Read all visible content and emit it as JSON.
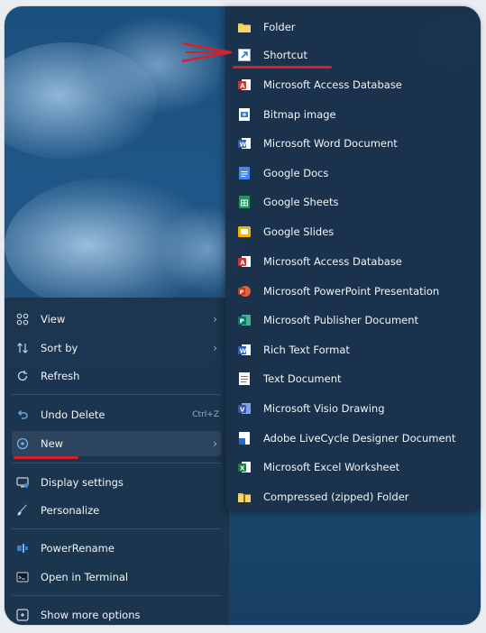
{
  "context_menu": {
    "items": [
      {
        "label": "View",
        "icon": "grid-icon",
        "arrow": "›"
      },
      {
        "label": "Sort by",
        "icon": "sort-icon",
        "arrow": "›"
      },
      {
        "label": "Refresh",
        "icon": "refresh-icon"
      },
      {
        "label": "Undo Delete",
        "icon": "undo-icon",
        "accelerator": "Ctrl+Z"
      },
      {
        "label": "New",
        "icon": "new-icon",
        "arrow": "›"
      },
      {
        "label": "Display settings",
        "icon": "display-settings-icon"
      },
      {
        "label": "Personalize",
        "icon": "brush-icon"
      },
      {
        "label": "PowerRename",
        "icon": "powerrename-icon"
      },
      {
        "label": "Open in Terminal",
        "icon": "terminal-icon"
      },
      {
        "label": "Show more options",
        "icon": "more-options-icon"
      }
    ]
  },
  "new_submenu": {
    "items": [
      {
        "label": "Folder",
        "icon": "folder-icon"
      },
      {
        "label": "Shortcut",
        "icon": "shortcut-icon"
      },
      {
        "label": "Microsoft Access Database",
        "icon": "access-icon"
      },
      {
        "label": "Bitmap image",
        "icon": "bitmap-icon"
      },
      {
        "label": "Microsoft Word Document",
        "icon": "word-icon"
      },
      {
        "label": "Google Docs",
        "icon": "google-docs-icon"
      },
      {
        "label": "Google Sheets",
        "icon": "google-sheets-icon"
      },
      {
        "label": "Google Slides",
        "icon": "google-slides-icon"
      },
      {
        "label": "Microsoft Access Database",
        "icon": "access-icon"
      },
      {
        "label": "Microsoft PowerPoint Presentation",
        "icon": "powerpoint-icon"
      },
      {
        "label": "Microsoft Publisher Document",
        "icon": "publisher-icon"
      },
      {
        "label": "Rich Text Format",
        "icon": "rtf-icon"
      },
      {
        "label": "Text Document",
        "icon": "text-document-icon"
      },
      {
        "label": "Microsoft Visio Drawing",
        "icon": "visio-icon"
      },
      {
        "label": "Adobe LiveCycle Designer Document",
        "icon": "adobe-livecycle-icon"
      },
      {
        "label": "Microsoft Excel Worksheet",
        "icon": "excel-icon"
      },
      {
        "label": "Compressed (zipped) Folder",
        "icon": "zip-folder-icon"
      }
    ]
  },
  "colors": {
    "annotation_red": "#d8202a",
    "menu_bg": "#1c344e",
    "wallpaper": "#1f5788"
  }
}
